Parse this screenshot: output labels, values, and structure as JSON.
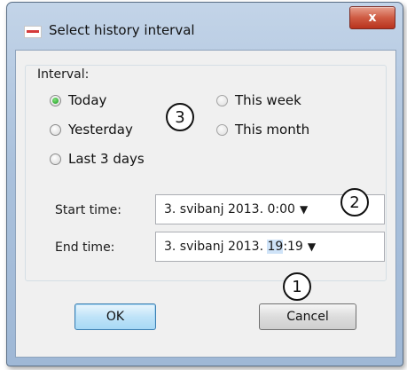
{
  "window": {
    "title": "Select history interval",
    "close_label": "x"
  },
  "interval": {
    "label": "Interval:",
    "options": [
      {
        "label": "Today",
        "checked": true
      },
      {
        "label": "Yesterday",
        "checked": false
      },
      {
        "label": "Last 3 days",
        "checked": false
      },
      {
        "label": "This week",
        "checked": false
      },
      {
        "label": "This month",
        "checked": false
      }
    ]
  },
  "start_time": {
    "label": "Start time:",
    "value": "3. svibanj 2013. 0:00",
    "arrow": "▼"
  },
  "end_time": {
    "label": "End time:",
    "value_before": "3. svibanj 2013. ",
    "value_selected": "19",
    "value_after": ":19",
    "arrow": "▼"
  },
  "callouts": {
    "one": "1",
    "two": "2",
    "three": "3"
  },
  "buttons": {
    "ok": "OK",
    "cancel": "Cancel"
  },
  "colors": {
    "titlebar": "#aac1dc",
    "close_button": "#cf5b43",
    "selection_highlight": "#cfe3f8",
    "radio_checked": "#1b9a20"
  }
}
